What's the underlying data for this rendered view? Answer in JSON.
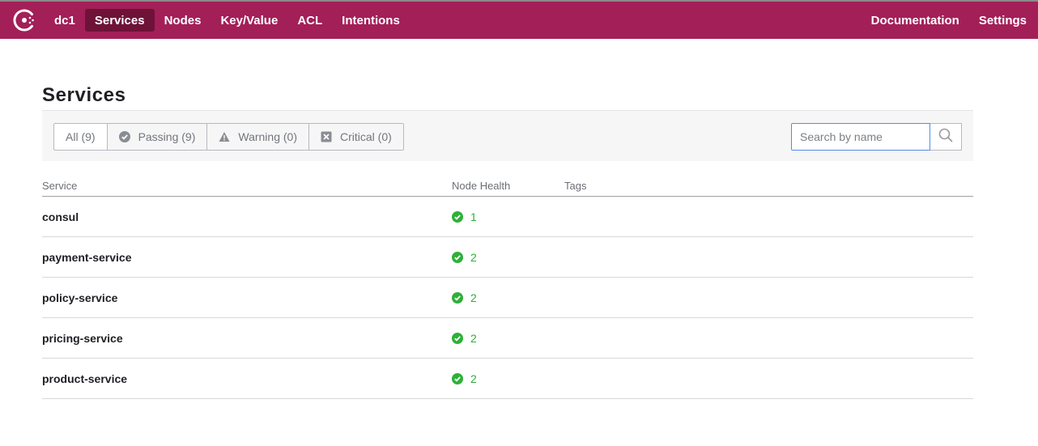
{
  "nav": {
    "datacenter": "dc1",
    "items": [
      "Services",
      "Nodes",
      "Key/Value",
      "ACL",
      "Intentions"
    ],
    "active": "Services",
    "right_items": [
      "Documentation",
      "Settings"
    ]
  },
  "page": {
    "title": "Services"
  },
  "filters": [
    {
      "label": "All (9)",
      "icon": "none"
    },
    {
      "label": "Passing (9)",
      "icon": "check-circle-icon"
    },
    {
      "label": "Warning (0)",
      "icon": "warning-triangle-icon"
    },
    {
      "label": "Critical (0)",
      "icon": "x-square-icon"
    }
  ],
  "search": {
    "placeholder": "Search by name",
    "value": ""
  },
  "table": {
    "headers": [
      "Service",
      "Node Health",
      "Tags"
    ],
    "rows": [
      {
        "service": "consul",
        "health": "1",
        "tags": ""
      },
      {
        "service": "payment-service",
        "health": "2",
        "tags": ""
      },
      {
        "service": "policy-service",
        "health": "2",
        "tags": ""
      },
      {
        "service": "pricing-service",
        "health": "2",
        "tags": ""
      },
      {
        "service": "product-service",
        "health": "2",
        "tags": ""
      }
    ]
  },
  "colors": {
    "brand": "#a31f58",
    "active_nav": "#6e1238",
    "passing": "#2eb039",
    "search_focus": "#4f8ee8"
  }
}
